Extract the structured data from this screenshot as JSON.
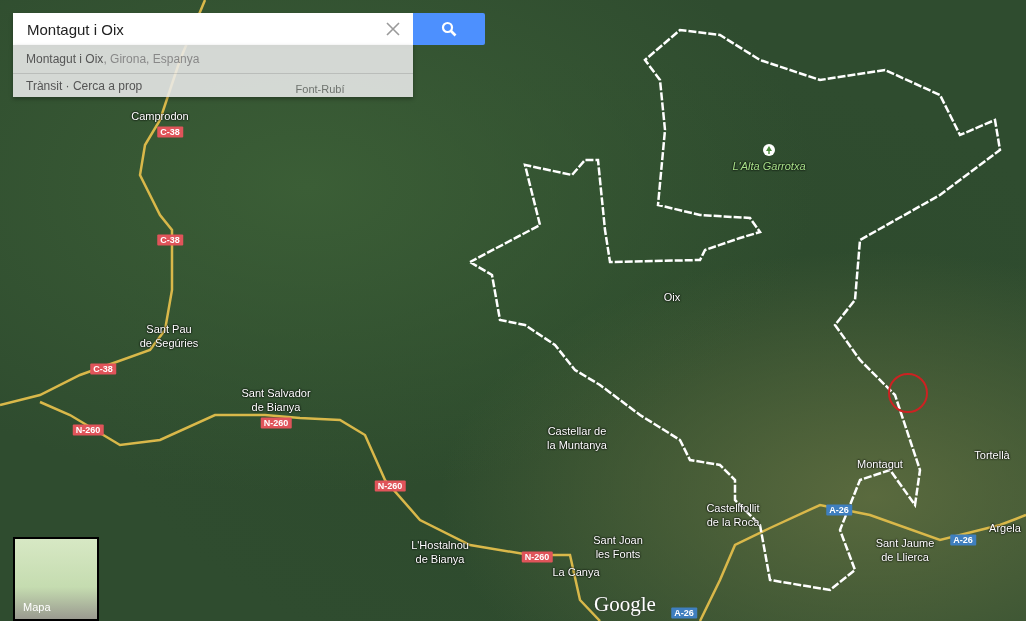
{
  "search": {
    "value": "Montagut i Oix"
  },
  "suggestions": [
    {
      "primary": "Montagut i Oix",
      "secondary": ", Girona, Espanya"
    }
  ],
  "suggestion_links": "Trànsit · Cerca a prop",
  "place_labels": [
    {
      "kind": "covered",
      "lines": [
        "Font-Rubí"
      ]
    },
    {
      "kind": "town",
      "lines": [
        "Camprodon"
      ]
    },
    {
      "kind": "park",
      "lines": [
        "L'Alta Garrotxa"
      ]
    },
    {
      "kind": "town",
      "lines": [
        "Oix"
      ]
    },
    {
      "kind": "town",
      "lines": [
        "Sant Pau",
        "de Segúries"
      ]
    },
    {
      "kind": "town",
      "lines": [
        "Sant Salvador",
        "de Bianya"
      ]
    },
    {
      "kind": "town",
      "lines": [
        "Castellar de",
        "la Muntanya"
      ]
    },
    {
      "kind": "town",
      "lines": [
        "Tortellà"
      ]
    },
    {
      "kind": "town",
      "lines": [
        "Montagut"
      ]
    },
    {
      "kind": "town",
      "lines": [
        "Castellfollit",
        "de la Roca"
      ]
    },
    {
      "kind": "town",
      "lines": [
        "Argela"
      ]
    },
    {
      "kind": "town",
      "lines": [
        "L'Hostalnou",
        "de Bianya"
      ]
    },
    {
      "kind": "town",
      "lines": [
        "Sant Joan",
        "les Fonts"
      ]
    },
    {
      "kind": "town",
      "lines": [
        "Sant Jaume",
        "de Llierca"
      ]
    },
    {
      "kind": "town",
      "lines": [
        "La Canya"
      ]
    }
  ],
  "road_shields": [
    {
      "text": "C-38",
      "color": "#e0545a"
    },
    {
      "text": "C-38",
      "color": "#e0545a"
    },
    {
      "text": "C-38",
      "color": "#e0545a"
    },
    {
      "text": "N-260",
      "color": "#e0545a"
    },
    {
      "text": "N-260",
      "color": "#e0545a"
    },
    {
      "text": "N-260",
      "color": "#e0545a"
    },
    {
      "text": "A-26",
      "color": "#3f7fbf"
    },
    {
      "text": "A-26",
      "color": "#3f7fbf"
    },
    {
      "text": "N-260",
      "color": "#e0545a"
    },
    {
      "text": "A-26",
      "color": "#3f7fbf"
    }
  ],
  "minimap": {
    "label": "Mapa"
  },
  "logo": "Google"
}
